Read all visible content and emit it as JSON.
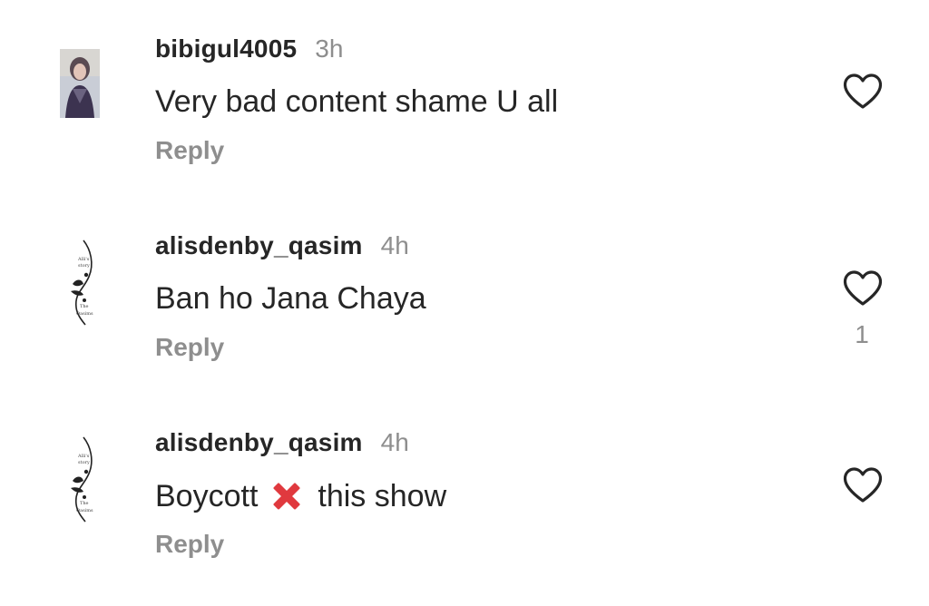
{
  "comments": [
    {
      "username": "bibigul4005",
      "time": "3h",
      "text": "Very bad content shame U all",
      "reply_label": "Reply",
      "likes": ""
    },
    {
      "username": "alisdenby_qasim",
      "time": "4h",
      "text": "Ban ho Jana Chaya",
      "reply_label": "Reply",
      "likes": "1"
    },
    {
      "username": "alisdenby_qasim",
      "time": "4h",
      "text_before": "Boycott",
      "emoji": "cross-mark-emoji",
      "text_after": "this show",
      "reply_label": "Reply",
      "likes": ""
    }
  ],
  "colors": {
    "text": "#262626",
    "secondary": "#8e8e8e",
    "emoji_red": "#e0393e"
  }
}
